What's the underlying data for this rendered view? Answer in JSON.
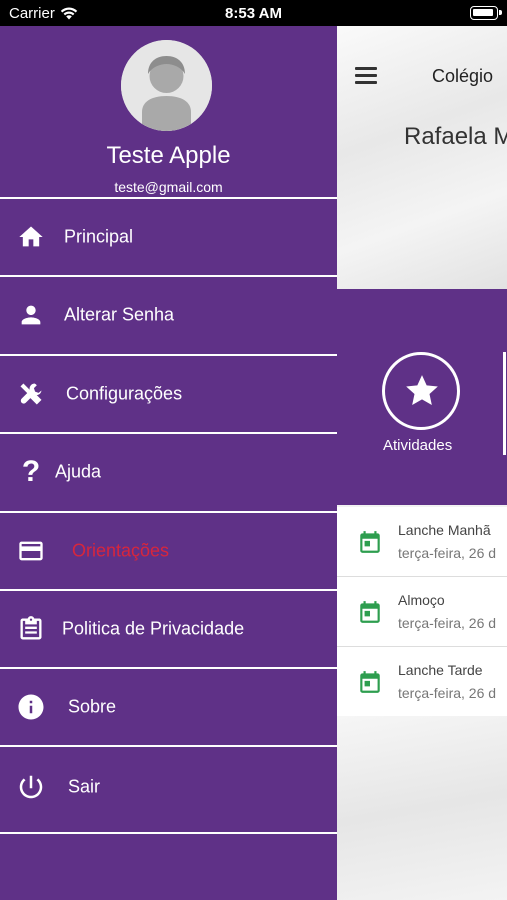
{
  "status_bar": {
    "carrier": "Carrier",
    "time": "8:53 AM"
  },
  "drawer": {
    "user_name": "Teste Apple",
    "user_email": "teste@gmail.com",
    "items": [
      {
        "label": "Principal",
        "icon": "home-icon"
      },
      {
        "label": "Alterar Senha",
        "icon": "person-icon"
      },
      {
        "label": "Configurações",
        "icon": "tools-icon"
      },
      {
        "label": "Ajuda",
        "icon": "question-icon"
      },
      {
        "label": "Orientações",
        "icon": "card-icon",
        "color": "#d7263d"
      },
      {
        "label": "Politica de Privacidade",
        "icon": "clipboard-icon"
      },
      {
        "label": "Sobre",
        "icon": "info-icon"
      },
      {
        "label": "Sair",
        "icon": "power-icon"
      }
    ],
    "background_color": "#5f3187"
  },
  "main": {
    "header_title": "Colégio",
    "student_name": "Rafaela M",
    "activities_label": "Atividades",
    "list": [
      {
        "title": "Lanche Manhã",
        "date": "terça-feira, 26 d"
      },
      {
        "title": "Almoço",
        "date": "terça-feira, 26 d"
      },
      {
        "title": "Lanche Tarde",
        "date": "terça-feira, 26 d"
      }
    ],
    "calendar_icon_color": "#2e9e4f"
  }
}
